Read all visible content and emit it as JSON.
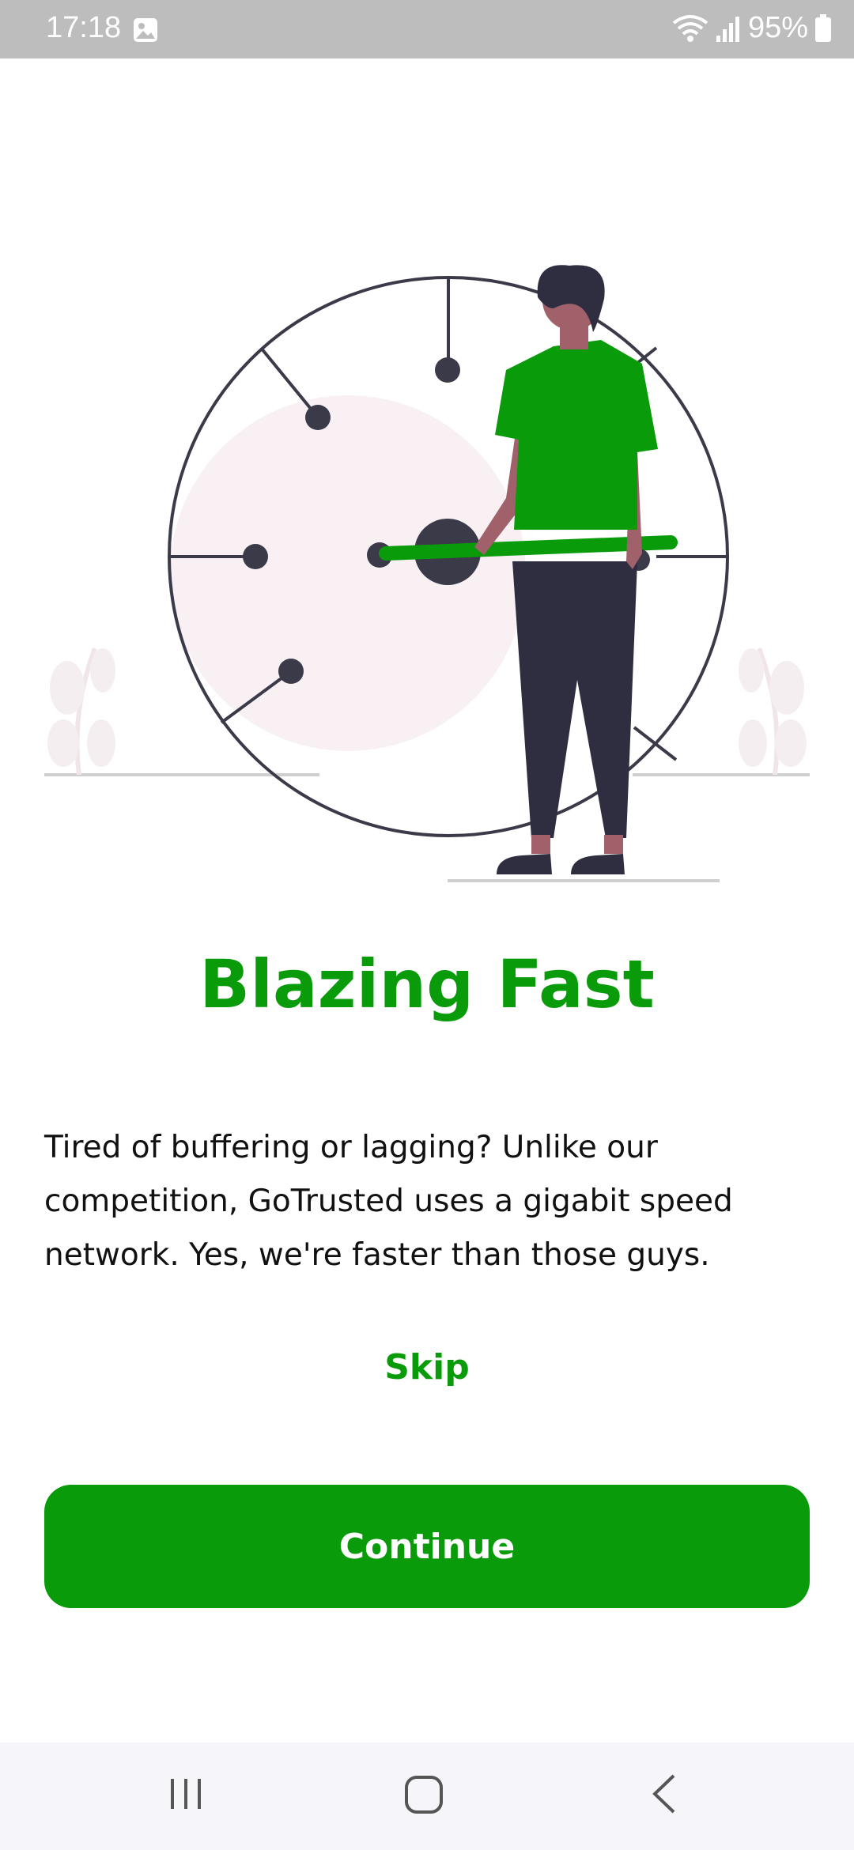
{
  "status_bar": {
    "time": "17:18",
    "battery_text": "95%",
    "icons": [
      "photo-icon",
      "wifi-icon",
      "signal-icon",
      "battery-icon"
    ]
  },
  "onboarding": {
    "title": "Blazing Fast",
    "description": "Tired of buffering or lagging? Unlike our competition, GoTrusted uses a gigabit speed network. Yes, we're faster than those guys.",
    "skip_label": "Skip",
    "continue_label": "Continue"
  },
  "nav_bar": {
    "icons": [
      "recents-icon",
      "home-icon",
      "back-icon"
    ]
  },
  "colors": {
    "accent": "#0a9b0a",
    "status_bar": "#bdbdbd",
    "nav_bar": "#f6f6fa",
    "figure_dark": "#2f2e41",
    "skin": "#a0616a"
  }
}
